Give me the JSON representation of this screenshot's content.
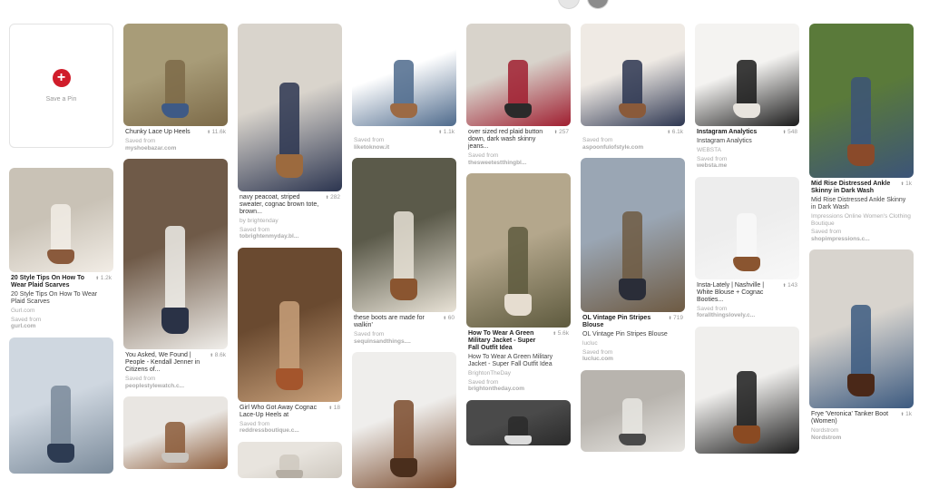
{
  "save_pin": {
    "label": "Save a Pin"
  },
  "columns": [
    [
      {
        "type": "save"
      },
      {
        "type": "pin",
        "img_h": 115,
        "palette": [
          "#c9c2b6",
          "#f2ede6",
          "#8a5a3c"
        ],
        "title": "20 Style Tips On How To Wear Plaid Scarves",
        "title_bold": true,
        "count": "1.2k",
        "sub": "20 Style Tips On How To Wear Plaid Scarves",
        "source": "Gurl.com",
        "saved": "Saved from",
        "site": "gurl.com"
      },
      {
        "type": "pin",
        "img_h": 150,
        "palette": [
          "#cfd7e0",
          "#7a8a9a",
          "#2d3b52"
        ],
        "cut": true
      }
    ],
    [
      {
        "type": "pin",
        "img_h": 113,
        "palette": [
          "#a89c78",
          "#7c6a48",
          "#3e5a86"
        ],
        "title": "Chunky Lace Up Heels",
        "title_bold": false,
        "count": "11.6k",
        "saved": "Saved from",
        "site": "myshoebazar.com"
      },
      {
        "type": "pin",
        "img_h": 210,
        "palette": [
          "#6f5a48",
          "#f0eeea",
          "#2a3246"
        ],
        "title": "You Asked, We Found | People - Kendall Jenner in Citizens of...",
        "title_bold": false,
        "count": "8.6k",
        "saved": "Saved from",
        "site": "peoplestylewatch.c..."
      },
      {
        "type": "pin",
        "img_h": 80,
        "palette": [
          "#e9e6e2",
          "#8b5a38",
          "#c9c4be"
        ],
        "cut": true
      }
    ],
    [
      {
        "type": "pin",
        "img_h": 185,
        "palette": [
          "#d9d4cc",
          "#2c3550",
          "#9c6a3e"
        ],
        "title": "navy peacoat, striped sweater, cognac brown tote, brown...",
        "title_bold": false,
        "count": "282",
        "source": "by brightenday",
        "saved": "Saved from",
        "site": "tobrightenmyday.bl..."
      },
      {
        "type": "pin",
        "img_h": 170,
        "palette": [
          "#6a4a30",
          "#c8a07a",
          "#a4552c"
        ],
        "title": "Girl Who Got Away Cognac Lace-Up Heels at",
        "title_bold": false,
        "count": "18",
        "saved": "Saved from",
        "site": "reddressboutique.c..."
      },
      {
        "type": "pin",
        "img_h": 40,
        "palette": [
          "#e8e4de",
          "#cfc9c0",
          "#b5aea4"
        ],
        "cut": true
      }
    ],
    [
      {
        "type": "pin",
        "img_h": 113,
        "palette": [
          "#ffffff",
          "#4e6a8c",
          "#9c6a44"
        ],
        "title": "",
        "title_bold": false,
        "count": "1.1k",
        "saved": "Saved from",
        "site": "liketoknow.it"
      },
      {
        "type": "pin",
        "img_h": 170,
        "palette": [
          "#5b5a4a",
          "#e8e2d6",
          "#8a5530"
        ],
        "title": "these boots are made for walkin'",
        "title_bold": false,
        "count": "60",
        "saved": "Saved from",
        "site": "sequinsandthings...."
      },
      {
        "type": "pin",
        "img_h": 150,
        "palette": [
          "#efeeec",
          "#7a4a2c",
          "#4a2e1c"
        ],
        "cut": true
      }
    ],
    [
      {
        "type": "pin",
        "img_h": 113,
        "palette": [
          "#d8d3cb",
          "#a01e30",
          "#2a2a2a"
        ],
        "title": "over sized red plaid button down, dark wash skinny jeans...",
        "title_bold": false,
        "count": "257",
        "saved": "Saved from",
        "site": "thesweetestthingbl..."
      },
      {
        "type": "pin",
        "img_h": 170,
        "palette": [
          "#b4a78c",
          "#5e5a3e",
          "#e6ddd0"
        ],
        "title": "How To Wear A Green Military Jacket - Super Fall Outfit Idea",
        "title_bold": true,
        "count": "5.6k",
        "sub": "How To Wear A Green Military Jacket - Super Fall Outfit Idea",
        "source": "BrightonTheDay",
        "saved": "Saved from",
        "site": "brightontheday.com"
      },
      {
        "type": "pin",
        "img_h": 50,
        "palette": [
          "#4a4a4a",
          "#2a2a2a",
          "#dcdcdc"
        ],
        "cut": true
      }
    ],
    [
      {
        "type": "pin",
        "img_h": 113,
        "palette": [
          "#efeae4",
          "#2c3550",
          "#8a5a3a"
        ],
        "title": "",
        "title_bold": false,
        "count": "6.1k",
        "saved": "Saved from",
        "site": "aspoonfulofstyle.com"
      },
      {
        "type": "pin",
        "img_h": 170,
        "palette": [
          "#9aa6b4",
          "#6e5a42",
          "#2a2d38"
        ],
        "title": "OL Vintage Pin Stripes Blouse",
        "title_bold": true,
        "count": "719",
        "sub": "OL Vintage Pin Stripes Blouse",
        "source": "lucluc",
        "saved": "Saved from",
        "site": "lucluc.com"
      },
      {
        "type": "pin",
        "img_h": 90,
        "palette": [
          "#b8b4ae",
          "#e8e6e2",
          "#4a4a4a"
        ],
        "cut": true
      }
    ],
    [
      {
        "type": "pin",
        "img_h": 113,
        "palette": [
          "#f4f3f1",
          "#1a1a1a",
          "#e8e4de"
        ],
        "title": "Instagram Analytics",
        "title_bold": true,
        "count": "548",
        "sub": "Instagram Analytics",
        "source": "WEBSTA",
        "saved": "Saved from",
        "site": "websta.me"
      },
      {
        "type": "pin",
        "img_h": 113,
        "palette": [
          "#ededed",
          "#f8f8f8",
          "#8a5530"
        ],
        "title": "Insta-Lately | Nashville | White Blouse + Cognac Booties...",
        "title_bold": false,
        "count": "143",
        "saved": "Saved from",
        "site": "forallthingslovely.c..."
      },
      {
        "type": "pin",
        "img_h": 140,
        "palette": [
          "#f0efed",
          "#1c1c1c",
          "#8a4a22"
        ],
        "cut": true
      }
    ],
    [
      {
        "type": "pin",
        "img_h": 170,
        "palette": [
          "#5a7a3a",
          "#3c5478",
          "#8a4a2a"
        ],
        "title": "Mid Rise Distressed Ankle Skinny in Dark Wash",
        "title_bold": true,
        "count": "1k",
        "sub": "Mid Rise Distressed Ankle Skinny in Dark Wash",
        "source": "Impressions Online Women's Clothing Boutique",
        "saved": "Saved from",
        "site": "shopimpressions.c..."
      },
      {
        "type": "pin",
        "img_h": 175,
        "palette": [
          "#d8d4ce",
          "#3c5a80",
          "#4a2818"
        ],
        "title": "Frye 'Veronica' Tanker Boot (Women)",
        "title_bold": false,
        "count": "1k",
        "sub": "",
        "source": "Nordstrom",
        "saved": "",
        "site": "Nordstrom"
      }
    ]
  ]
}
